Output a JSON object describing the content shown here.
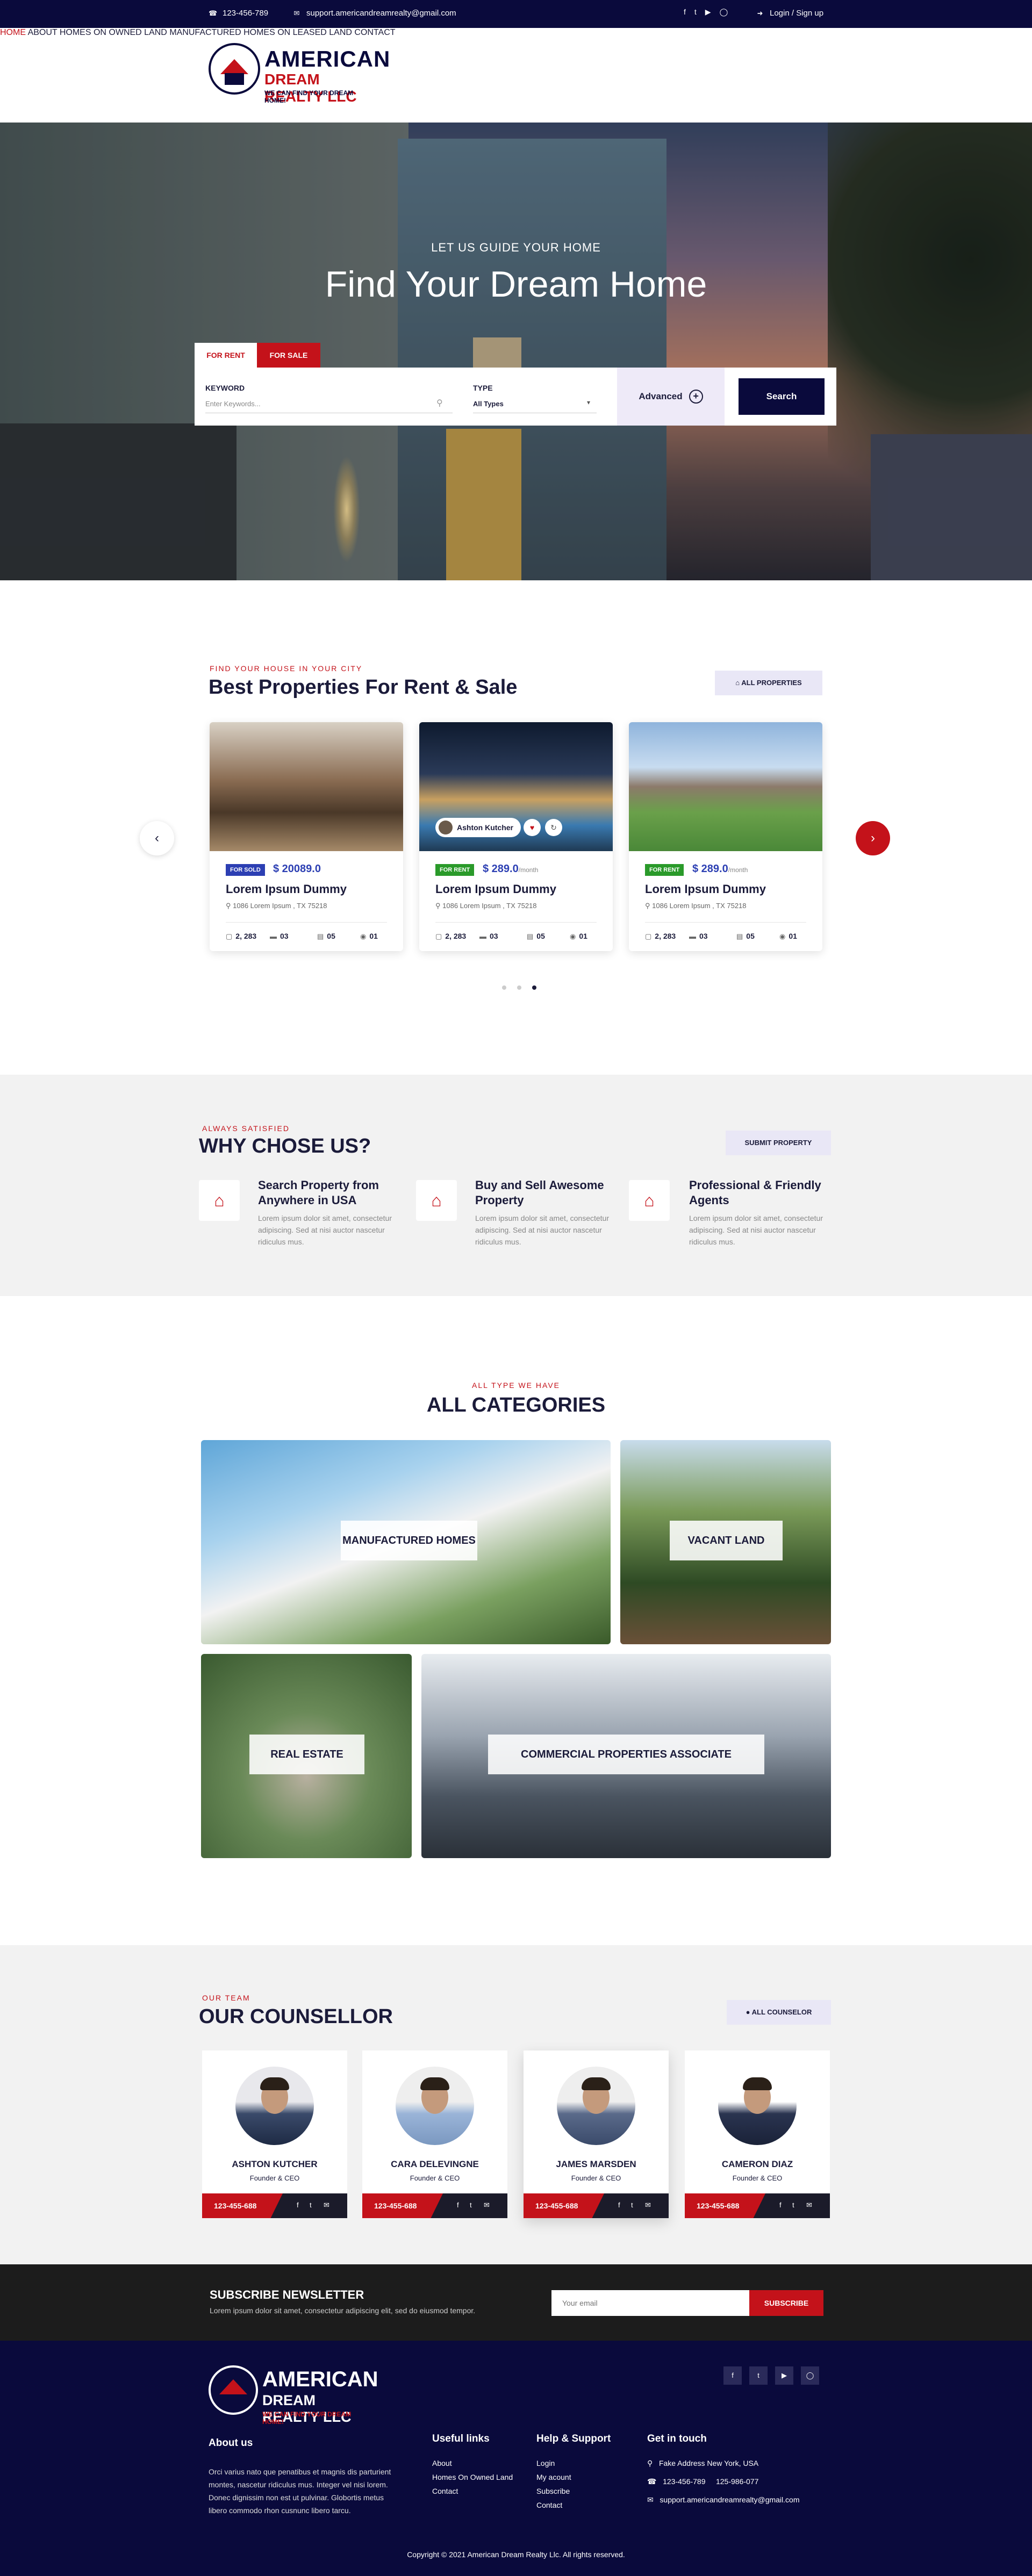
{
  "topbar": {
    "phone": "123-456-789",
    "email": "support.americandreamrealty@gmail.com",
    "social": [
      "facebook-icon",
      "twitter-icon",
      "youtube-icon",
      "instagram-icon"
    ],
    "login": "Login / Sign up"
  },
  "brand": {
    "line1": "AMERICAN",
    "line2": "DREAM REALTY LLC",
    "tagline": "WE CAN FIND YOUR DREAM HOME!"
  },
  "nav": {
    "items": [
      "HOME",
      "ABOUT",
      "HOMES ON OWNED LAND",
      "MANUFACTURED HOMES ON LEASED LAND",
      "CONTACT"
    ],
    "active": "HOME"
  },
  "hero": {
    "subtitle": "LET US GUIDE YOUR HOME",
    "title": "Find Your Dream Home",
    "tab_rent": "FOR RENT",
    "tab_sale": "FOR SALE",
    "keyword_label": "KEYWORD",
    "keyword_placeholder": "Enter Keywords...",
    "type_label": "TYPE",
    "type_value": "All Types",
    "advanced": "Advanced",
    "search": "Search"
  },
  "properties": {
    "eyebrow": "FIND YOUR HOUSE IN YOUR CITY",
    "title": "Best Properties For Rent & Sale",
    "all_button": "ALL PROPERTIES",
    "cards": [
      {
        "badge": "FOR SOLD",
        "badge_color": "#2c3fb3",
        "price": "$ 20089.0",
        "period": "",
        "title": "Lorem Ipsum Dummy",
        "address": "1086 Lorem Ipsum , TX 75218",
        "area": "2, 283",
        "beds": "03",
        "baths": "05",
        "garage": "01"
      },
      {
        "badge": "FOR RENT",
        "badge_color": "#2a9a2a",
        "price": "$ 289.0",
        "period": "/month",
        "title": "Lorem Ipsum Dummy",
        "address": "1086 Lorem Ipsum , TX 75218",
        "area": "2, 283",
        "beds": "03",
        "baths": "05",
        "garage": "01",
        "agent": "Ashton Kutcher"
      },
      {
        "badge": "FOR RENT",
        "badge_color": "#2a9a2a",
        "price": "$ 289.0",
        "period": "/month",
        "title": "Lorem Ipsum Dummy",
        "address": "1086 Lorem Ipsum , TX 75218",
        "area": "2, 283",
        "beds": "03",
        "baths": "05",
        "garage": "01"
      }
    ]
  },
  "why": {
    "eyebrow": "ALWAYS SATISFIED",
    "title": "WHY CHOSE US?",
    "button": "SUBMIT PROPERTY",
    "features": [
      {
        "title": "Search Property from Anywhere in USA",
        "desc": "Lorem ipsum dolor sit amet, consectetur adipiscing. Sed at nisi auctor nascetur ridiculus mus."
      },
      {
        "title": "Buy and Sell Awesome Property",
        "desc": "Lorem ipsum dolor sit amet, consectetur adipiscing. Sed at nisi auctor nascetur ridiculus mus."
      },
      {
        "title": "Professional & Friendly Agents",
        "desc": "Lorem ipsum dolor sit amet, consectetur adipiscing. Sed at nisi auctor nascetur ridiculus mus."
      }
    ]
  },
  "categories": {
    "eyebrow": "ALL TYPE WE HAVE",
    "title": "ALL CATEGORIES",
    "items": [
      "MANUFACTURED HOMES",
      "VACANT LAND",
      "REAL ESTATE",
      "COMMERCIAL PROPERTIES ASSOCIATE"
    ]
  },
  "team": {
    "eyebrow": "OUR TEAM",
    "title": "OUR COUNSELLOR",
    "button": "ALL COUNSELOR",
    "members": [
      {
        "name": "ASHTON KUTCHER",
        "role": "Founder & CEO",
        "phone": "123-455-688"
      },
      {
        "name": "CARA DELEVINGNE",
        "role": "Founder & CEO",
        "phone": "123-455-688"
      },
      {
        "name": "JAMES MARSDEN",
        "role": "Founder & CEO",
        "phone": "123-455-688"
      },
      {
        "name": "CAMERON DIAZ",
        "role": "Founder & CEO",
        "phone": "123-455-688"
      }
    ]
  },
  "newsletter": {
    "title": "SUBSCRIBE NEWSLETTER",
    "desc": "Lorem ipsum dolor sit amet, consectetur adipiscing elit, sed do eiusmod tempor.",
    "placeholder": "Your email",
    "button": "SUBSCRIBE"
  },
  "footer": {
    "about_title": "About us",
    "about_text": "Orci varius nato que penatibus et magnis dis parturient montes, nascetur ridiculus mus. Integer vel nisi lorem. Donec dignissim non est ut pulvinar. Globortis metus libero commodo rhon cusnunc libero tarcu.",
    "useful_title": "Useful links",
    "useful": [
      "About",
      "Homes On Owned Land",
      "Contact"
    ],
    "help_title": "Help & Support",
    "help": [
      "Login",
      "My acount",
      "Subscribe",
      "Contact"
    ],
    "touch_title": "Get in touch",
    "address": "Fake Address New York, USA",
    "phones": "123-456-789     125-986-077",
    "email": "support.americandreamrealty@gmail.com",
    "copyright": "Copyright © 2021 American Dream Realty Llc. All rights reserved."
  },
  "colors": {
    "navy": "#0a0a3c",
    "red": "#c4121a",
    "blue": "#2c3fb3"
  }
}
